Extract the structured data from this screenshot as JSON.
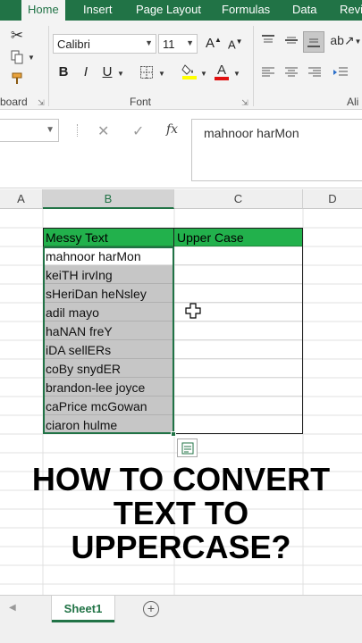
{
  "ribbon": {
    "tabs": [
      "Home",
      "Insert",
      "Page Layout",
      "Formulas",
      "Data",
      "Revi"
    ],
    "active_tab": "Home",
    "groups": {
      "clipboard_label": "board",
      "font_label": "Font",
      "alignment_label": "Ali"
    },
    "font_name": "Calibri",
    "font_size": "11",
    "bold": "B",
    "italic": "I",
    "underline": "U",
    "grow": "A",
    "shrink": "A",
    "font_color_letter": "A"
  },
  "formula_bar": {
    "name_box": "",
    "cancel": "✕",
    "enter": "✓",
    "fx": "fx",
    "content": "mahnoor harMon"
  },
  "columns": [
    "A",
    "B",
    "C",
    "D"
  ],
  "table": {
    "headers": [
      "Messy Text",
      "Upper Case"
    ],
    "rows": [
      "mahnoor harMon",
      "keiTH irvIng",
      "sHeriDan heNsley",
      "adil mayo",
      "haNAN freY",
      "iDA sellERs",
      "coBy snydER",
      "brandon-lee joyce",
      "caPrice mcGowan",
      "ciaron hulme"
    ]
  },
  "overlay": {
    "line1": "HOW TO CONVERT",
    "line2": "TEXT TO",
    "line3": "UPPERCASE?"
  },
  "sheets": {
    "active": "Sheet1",
    "add": "+"
  },
  "colors": {
    "excel_green": "#217346",
    "header_fill": "#22b14c",
    "selection_fill": "#c6c6c6"
  }
}
